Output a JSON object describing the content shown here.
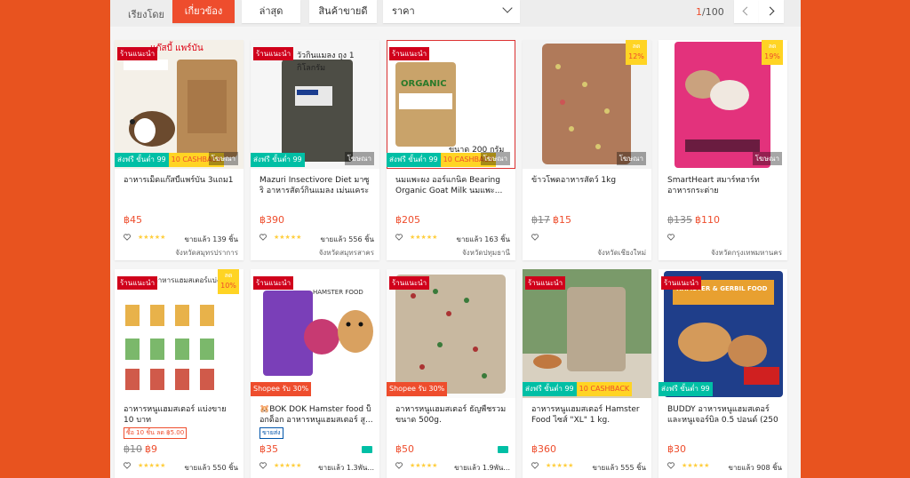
{
  "sort_bar": {
    "label": "เรียงโดย",
    "relevance": "เกี่ยวข้อง",
    "latest": "ล่าสุด",
    "top_sales": "สินค้าขายดี",
    "price": "ราคา",
    "page_current": "1",
    "page_total": "/100"
  },
  "colors": {
    "brand": "#ee4d2d",
    "background": "#e8531f"
  },
  "products": [
    {
      "badge": "ร้านแนะนำ",
      "title": "อาหารเม็ดแก๊สบี้แพร์บัน 3แถม1",
      "price": "฿45",
      "rating": "★★★★★",
      "sold": "ขายแล้ว 139 ชิ้น",
      "location": "จังหวัดสมุทรปราการ",
      "img_text": "แก๊สบี้ แพร์บัน",
      "strip1": "ส่งฟรี ขั้นต่ำ 99",
      "strip2": "10 CASHBACK",
      "ad": "โฆษณา"
    },
    {
      "badge": "ร้านแนะนำ",
      "title": "Mazuri Insectivore Diet มาซูริ อาหารสัตว์กินแมลง เม่นแคระ ถุง...",
      "price": "฿390",
      "rating": "★★★★★",
      "sold": "ขายแล้ว 556 ชิ้น",
      "location": "จังหวัดสมุทรสาคร",
      "img_text": "วัวกินแมลง ถุง 1 กิโลกรัม",
      "strip1": "ส่งฟรี ขั้นต่ำ 99",
      "ad": "โฆษณา"
    },
    {
      "badge": "ร้านแนะนำ",
      "title": "นมแพะผง ออร์แกนิค Bearing Organic Goat Milk นมแพะ...",
      "price": "฿205",
      "rating": "★★★★★",
      "sold": "ขายแล้ว 163 ชิ้น",
      "location": "จังหวัดปทุมธานี",
      "img_text": "ORGANIC",
      "img_sub": "ขนาด 200 กรัม",
      "strip1": "ส่งฟรี ขั้นต่ำ 99",
      "strip2": "10 CASHBACK",
      "ad": "โฆษณา"
    },
    {
      "title": "ข้าวโพดอาหารสัตว์ 1kg",
      "price_old": "฿17",
      "price": "฿15",
      "location": "จังหวัดเชียงใหม่",
      "disc_top": "ลด",
      "disc_val": "12%",
      "ad": "โฆษณา"
    },
    {
      "title": "SmartHeart สมาร์ทฮาร์ท อาหารกระต่าย",
      "price_old": "฿135",
      "price": "฿110",
      "location": "จังหวัดกรุงเทพมหานคร",
      "disc_top": "ลด",
      "disc_val": "19%",
      "ad": "โฆษณา"
    },
    {
      "badge": "ร้านแนะนำ",
      "title": "อาหารหนูแฮมสเตอร์ แบ่งขาย 10 บาท",
      "promo": "ซื้อ 10 ชิ้น ลด ฿5.00",
      "price_old": "฿10",
      "price": "฿9",
      "rating": "★★★★★",
      "sold": "ขายแล้ว 550 ชิ้น",
      "disc_top": "ลด",
      "disc_val": "10%",
      "img_text": "อาหารแฮมสเตอร์แบ่งขาย"
    },
    {
      "badge": "ร้านแนะนำ",
      "title": "🐹BOK DOK Hamster food บ็อกด็อก อาหารหนูแฮมสเตอร์ สู...",
      "tag": "ขายส่ง",
      "price": "฿35",
      "rating": "★★★★★",
      "sold": "ขายแล้ว 1.3พัน...",
      "img_text": "HAMSTER FOOD",
      "strip1": "Shopee รับ 30%"
    },
    {
      "badge": "ร้านแนะนำ",
      "title": "อาหารหนูแฮมสเตอร์ ธัญพืชรวม ขนาด 500g.",
      "price": "฿50",
      "rating": "★★★★★",
      "sold": "ขายแล้ว 1.9พัน...",
      "strip1": "Shopee รับ 30%"
    },
    {
      "badge": "ร้านแนะนำ",
      "title": "อาหารหนูแฮมสเตอร์ Hamster Food ไซส์ \"XL\" 1 kg.",
      "price": "฿360",
      "rating": "★★★★★",
      "sold": "ขายแล้ว 555 ชิ้น",
      "strip1": "ส่งฟรี ขั้นต่ำ 99",
      "strip2": "10 CASHBACK"
    },
    {
      "badge": "ร้านแนะนำ",
      "title": "BUDDY อาหารหนูแฮมสเตอร์และหนูเจอร์บิล 0.5 ปอนด์ (250 กรัม)",
      "price": "฿30",
      "rating": "★★★★★",
      "sold": "ขายแล้ว 908 ชิ้น",
      "img_text": "HAMSTER & GERBIL FOOD",
      "strip1": "ส่งฟรี ขั้นต่ำ 99"
    }
  ]
}
